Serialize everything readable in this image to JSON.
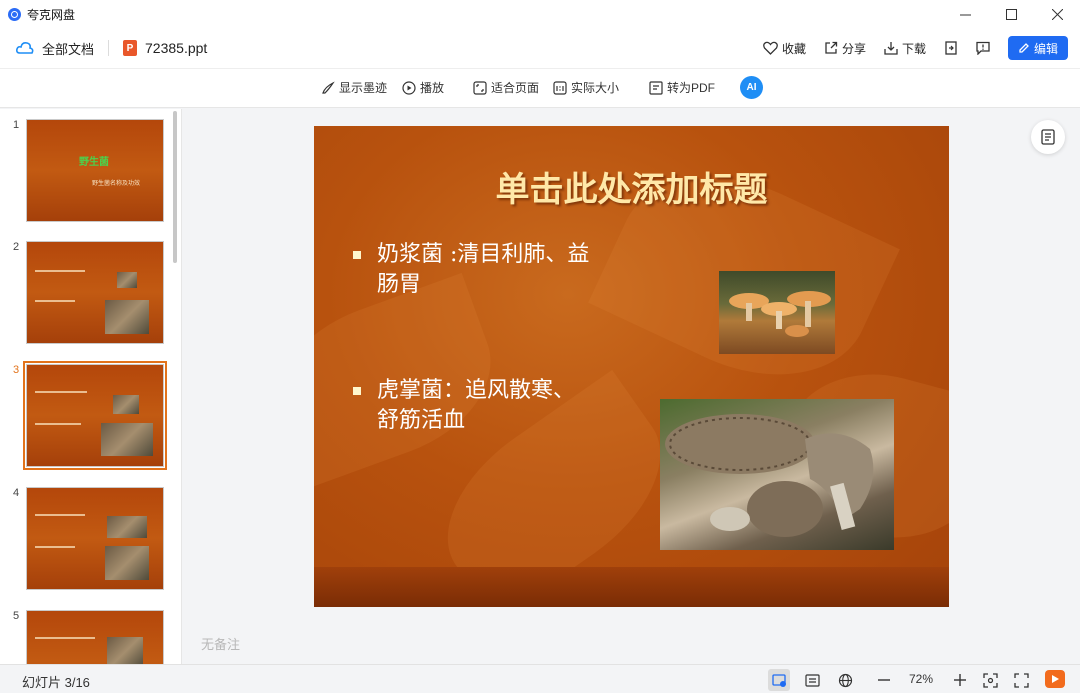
{
  "app": {
    "name": "夸克网盘"
  },
  "window_controls": [
    "minimize",
    "maximize",
    "close"
  ],
  "header": {
    "breadcrumb_root": "全部文档",
    "file_name": "72385.ppt",
    "file_type_letter": "P",
    "actions": {
      "favorite": "收藏",
      "share": "分享",
      "download": "下载",
      "edit": "编辑"
    }
  },
  "toolbar": {
    "show_ink": "显示墨迹",
    "play": "播放",
    "fit_page": "适合页面",
    "actual_size": "实际大小",
    "to_pdf": "转为PDF",
    "ai_label": "AI"
  },
  "sidebar": {
    "active_index": 3,
    "thumbnails": [
      {
        "number": "1",
        "title": "野生菌",
        "subtitle": "野生菌名称及功效"
      },
      {
        "number": "2"
      },
      {
        "number": "3"
      },
      {
        "number": "4"
      },
      {
        "number": "5"
      }
    ]
  },
  "slide": {
    "title": "单击此处添加标题",
    "bullets": [
      {
        "line1": "奶浆菌 :清目利肺、益",
        "line2": "肠胃"
      },
      {
        "line1": "虎掌菌：追风散寒、",
        "line2": "舒筋活血"
      }
    ]
  },
  "notes_placeholder": "无备注",
  "status": {
    "slide_counter": "幻灯片 3/16",
    "zoom": "72%"
  },
  "colors": {
    "accent": "#1f6bf2",
    "active_thumb": "#e2731b",
    "slide_bg": "#b8520e",
    "slide_title": "#ffe8a8"
  }
}
